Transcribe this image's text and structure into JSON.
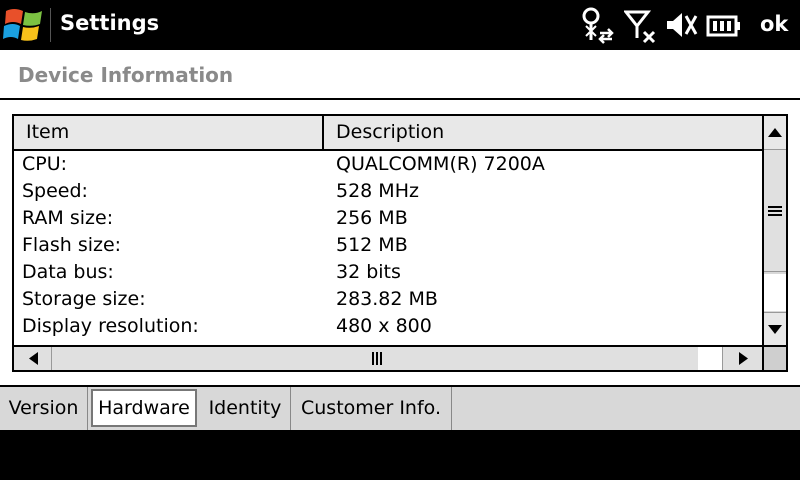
{
  "titlebar": {
    "title": "Settings",
    "ok_label": "ok",
    "icons": [
      "windows-start-icon",
      "connectivity-icon",
      "signal-off-icon",
      "volume-muted-icon",
      "battery-icon"
    ]
  },
  "header": {
    "title": "Device Information"
  },
  "table": {
    "columns": [
      "Item",
      "Description"
    ],
    "rows": [
      {
        "item": "CPU:",
        "description": "QUALCOMM(R) 7200A"
      },
      {
        "item": "Speed:",
        "description": "528 MHz"
      },
      {
        "item": "RAM size:",
        "description": "256 MB"
      },
      {
        "item": "Flash size:",
        "description": "512 MB"
      },
      {
        "item": "Data bus:",
        "description": "32 bits"
      },
      {
        "item": "Storage size:",
        "description": "283.82 MB"
      },
      {
        "item": "Display resolution:",
        "description": "480 x 800"
      }
    ]
  },
  "tabs": [
    {
      "label": "Version",
      "active": false
    },
    {
      "label": "Hardware",
      "active": true
    },
    {
      "label": "Identity",
      "active": false
    },
    {
      "label": "Customer Info.",
      "active": false
    }
  ]
}
